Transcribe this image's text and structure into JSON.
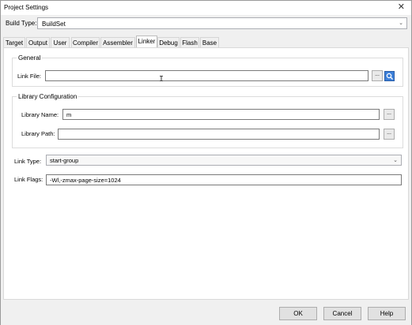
{
  "window": {
    "title": "Project Settings",
    "close_icon": "close-icon"
  },
  "build_type": {
    "label": "Build Type:",
    "value": "BuildSet"
  },
  "tabs": [
    {
      "label": "Target"
    },
    {
      "label": "Output"
    },
    {
      "label": "User"
    },
    {
      "label": "Compiler"
    },
    {
      "label": "Assembler"
    },
    {
      "label": "Linker"
    },
    {
      "label": "Debug"
    },
    {
      "label": "Flash"
    },
    {
      "label": "Base"
    }
  ],
  "active_tab": "Linker",
  "general": {
    "legend": "General",
    "link_file_label": "Link File:",
    "link_file_value": "",
    "browse_label": "...",
    "open_icon": "search-icon"
  },
  "library": {
    "legend": "Library Configuration",
    "name_label": "Library Name:",
    "name_value": "m",
    "path_label": "Library Path:",
    "path_value": "",
    "browse_label": "..."
  },
  "link_type": {
    "label": "Link Type:",
    "value": "start-group"
  },
  "link_flags": {
    "label": "Link Flags:",
    "value": "-Wl,-zmax-page-size=1024"
  },
  "footer": {
    "ok": "OK",
    "cancel": "Cancel",
    "help": "Help"
  }
}
